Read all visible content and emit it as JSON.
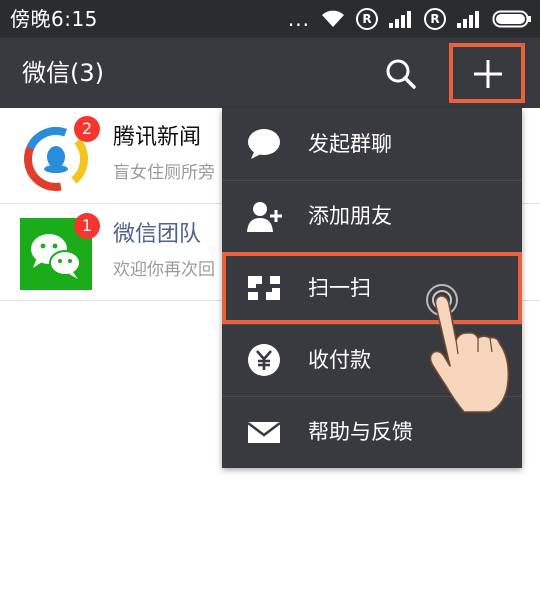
{
  "status_bar": {
    "time": "傍晚6:15",
    "dots": "...",
    "registered_mark": "R"
  },
  "header": {
    "title": "微信(3)",
    "search_icon": "search-icon",
    "plus_icon": "plus-icon"
  },
  "chats": [
    {
      "name": "腾讯新闻",
      "preview": "盲女住厕所旁",
      "unread": "2",
      "avatar": "tencent-news-logo"
    },
    {
      "name": "微信团队",
      "preview": "欢迎你再次回",
      "unread": "1",
      "avatar": "wechat-logo"
    }
  ],
  "menu": {
    "items": [
      {
        "label": "发起群聊",
        "icon": "chat-bubble-icon"
      },
      {
        "label": "添加朋友",
        "icon": "add-friend-icon"
      },
      {
        "label": "扫一扫",
        "icon": "scan-icon"
      },
      {
        "label": "收付款",
        "icon": "yuan-icon"
      },
      {
        "label": "帮助与反馈",
        "icon": "mail-icon"
      }
    ]
  },
  "colors": {
    "status_bar": "#2b2c30",
    "header": "#393a3f",
    "menu": "#393a3f",
    "highlight": "#e8613c",
    "badge": "#f43530",
    "wechat_green": "#1aad19"
  }
}
